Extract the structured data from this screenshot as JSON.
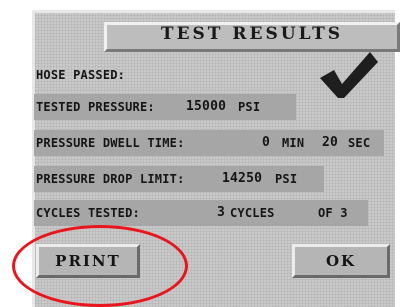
{
  "dialog": {
    "title": "TEST RESULTS",
    "hose_status": "HOSE PASSED:",
    "tested_pressure_label": "TESTED PRESSURE:",
    "tested_pressure_value": "15000",
    "tested_pressure_unit": "PSI",
    "dwell_label": "PRESSURE DWELL TIME:",
    "dwell_min_value": "0",
    "dwell_min_unit": "MIN",
    "dwell_sec_value": "20",
    "dwell_sec_unit": "SEC",
    "drop_label": "PRESSURE DROP LIMIT:",
    "drop_value": "14250",
    "drop_unit": "PSI",
    "cycles_label": "CYCLES TESTED:",
    "cycles_value": "3",
    "cycles_unit": "CYCLES",
    "cycles_of": "OF 3"
  },
  "buttons": {
    "print_label": "PRINT",
    "ok_label": "OK"
  },
  "icons": {
    "pass_check": "checkmark-icon",
    "highlight": "red-ellipse-annotation"
  },
  "colors": {
    "check": "#1e1e1e",
    "annotation": "#e8161c"
  }
}
